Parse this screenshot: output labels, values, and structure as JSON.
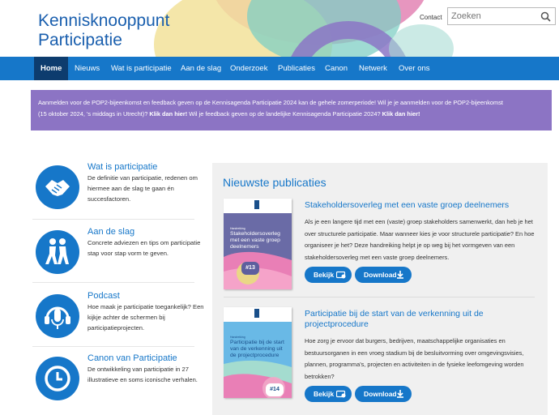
{
  "brand": {
    "line1": "Kennisknooppunt",
    "line2": "Participatie"
  },
  "header": {
    "contact": "Contact",
    "search_placeholder": "Zoeken",
    "search_icon": "search-icon"
  },
  "nav": {
    "items": [
      {
        "label": "Home",
        "active": true
      },
      {
        "label": "Nieuws"
      },
      {
        "label": "Wat is participatie"
      },
      {
        "label": "Aan de slag"
      },
      {
        "label": "Onderzoek"
      },
      {
        "label": "Publicaties"
      },
      {
        "label": "Canon"
      },
      {
        "label": "Netwerk"
      },
      {
        "label": "Over ons"
      }
    ]
  },
  "notice": {
    "text1": "Aanmelden voor de POP2-bijeenkomst en feedback geven op de Kennisagenda Participatie 2024 kan de gehele zomerperiode! Wil je je aanmelden voor de POP2-bijeenkomst",
    "text2a": "(15 oktober 2024, 's middags in Utrecht)?",
    "link1": "Klik dan hier!",
    "text2b": "Wil je feedback geven op de landelijke Kennisagenda Participatie 2024?",
    "link2": "Klik dan hier!"
  },
  "sidebar": {
    "items": [
      {
        "title": "Wat is participatie",
        "desc": "De definitie van participatie, redenen om hiermee aan de slag te gaan én succesfactoren.",
        "icon": "handshake-icon"
      },
      {
        "title": "Aan de slag",
        "desc": "Concrete adviezen en tips om participatie stap voor stap vorm te geven.",
        "icon": "walking-people-icon"
      },
      {
        "title": "Podcast",
        "desc": "Hoe maak je participatie toegankelijk? Een kijkje achter de schermen bij participatieprojecten.",
        "icon": "headset-microphone-icon"
      },
      {
        "title": "Canon van Participatie",
        "desc": "De ontwikkeling van participatie in 27 illustratieve en soms iconische verhalen.",
        "icon": "clock-icon"
      }
    ]
  },
  "publications": {
    "heading": "Nieuwste publicaties",
    "items": [
      {
        "title": "Stakeholdersoverleg met een vaste groep deelnemers",
        "desc": "Als je een langere tijd met een (vaste) groep stakeholders samenwerkt, dan heb je het over structurele participatie. Maar wanneer kies je voor structurele participatie? En hoe organiseer je het? Deze handreiking helpt je op weg bij het vormgeven van een stakeholdersoverleg met een vaste groep deelnemers.",
        "cover_label": "Handreiking",
        "cover_title": "Stakeholdersoverleg met een vaste groep deelnemers",
        "cover_number": "#13",
        "view_label": "Bekijk",
        "download_label": "Download"
      },
      {
        "title": "Participatie bij de start van de verkenning uit de projectprocedure",
        "desc": "Hoe zorg je ervoor dat burgers, bedrijven, maatschappelijke organisaties en bestuursorganen in een vroeg stadium bij de besluitvorming over omgevingsvisies, plannen, programma's, projecten en activiteiten in de fysieke leefomgeving worden betrokken?",
        "cover_label": "Handreiking",
        "cover_title": "Participatie bij de start van de verkenning uit de projectprocedure",
        "cover_number": "#14",
        "view_label": "Bekijk",
        "download_label": "Download"
      }
    ]
  },
  "colors": {
    "primary": "#1677c9",
    "nav_active": "#0d3c6e",
    "notice": "#8c74c4",
    "panel": "#f0f0f0"
  }
}
